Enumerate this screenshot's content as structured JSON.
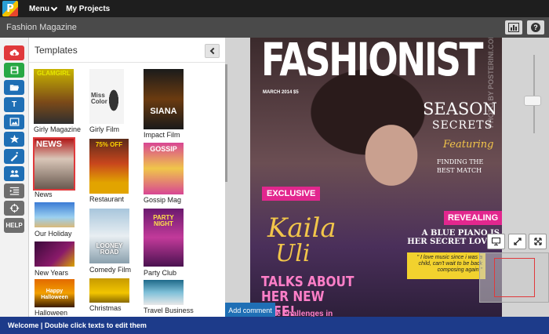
{
  "topbar": {
    "logo_letter": "P",
    "menu_label": "Menu",
    "projects_label": "My Projects"
  },
  "titlebar": {
    "title": "Fashion Magazine"
  },
  "tools": {
    "text_label": "T",
    "help_label": "HELP"
  },
  "panel": {
    "title": "Templates",
    "templates": [
      {
        "label": "Girly Magazine",
        "thumb_text": "GLAMGIRL"
      },
      {
        "label": "Girly Film",
        "thumb_text": "Miss Color"
      },
      {
        "label": "Impact Film",
        "thumb_text": "SIANA"
      },
      {
        "label": "News",
        "thumb_text": "NEWS"
      },
      {
        "label": "Restaurant",
        "thumb_text": "75% OFF"
      },
      {
        "label": "Gossip Mag",
        "thumb_text": "GOSSIP"
      },
      {
        "label": "Our Holiday",
        "thumb_text": ""
      },
      {
        "label": "Comedy Film",
        "thumb_text": "LOONEY ROAD"
      },
      {
        "label": "Party Club",
        "thumb_text": "PARTY NIGHT"
      },
      {
        "label": "New Years",
        "thumb_text": ""
      },
      {
        "label": "Christmas",
        "thumb_text": ""
      },
      {
        "label": "Travel Business",
        "thumb_text": ""
      },
      {
        "label": "Halloween",
        "thumb_text": "Happy Halloween"
      }
    ]
  },
  "cover": {
    "masthead": "FASHIONIST",
    "issue": "MARCH 2014  $5",
    "season": "SEASON",
    "secrets": "SECRETS",
    "featuring": "Featuring",
    "finding": "FINDING THE BEST MATCH",
    "exclusive": "EXCLUSIVE",
    "name_first": "Kaila",
    "name_last": "Uli",
    "revealing": "REVEALING",
    "blue_piano": "A BLUE PIANO IS HER SECRET LOVER",
    "quote": "\" I love music since i was a child, can't wait to be back composing again \"",
    "talks": "TALKS ABOUT HER NEW LIFE!",
    "challenges": "ce challenges in",
    "credit": "PHOTO BY POSTERINI.COM"
  },
  "actions": {
    "add_comment": "Add comment"
  },
  "status": {
    "text": "Welcome | Double click texts to edit them"
  }
}
